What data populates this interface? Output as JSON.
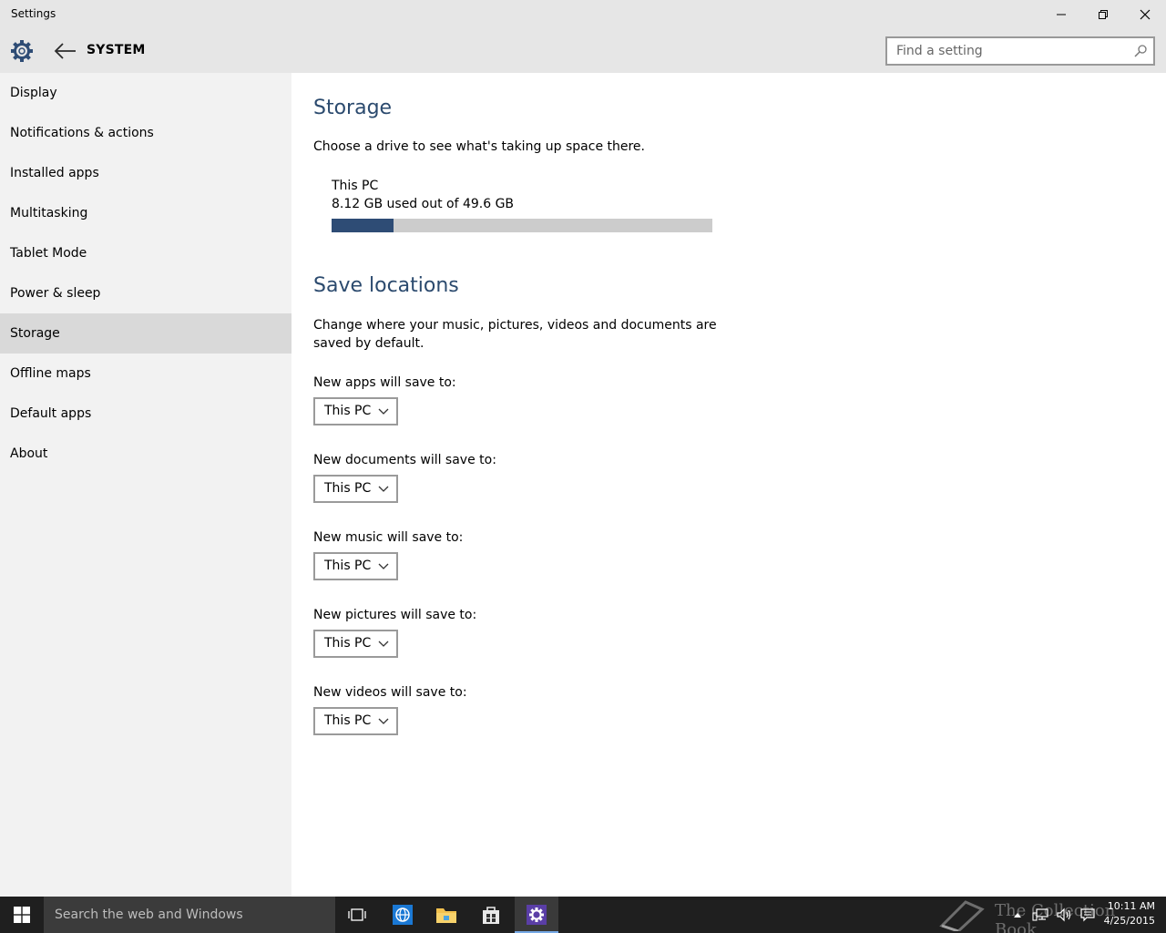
{
  "window": {
    "title": "Settings"
  },
  "header": {
    "section": "SYSTEM",
    "search_placeholder": "Find a setting"
  },
  "sidebar": {
    "items": [
      {
        "label": "Display"
      },
      {
        "label": "Notifications & actions"
      },
      {
        "label": "Installed apps"
      },
      {
        "label": "Multitasking"
      },
      {
        "label": "Tablet Mode"
      },
      {
        "label": "Power & sleep"
      },
      {
        "label": "Storage",
        "active": true
      },
      {
        "label": "Offline maps"
      },
      {
        "label": "Default apps"
      },
      {
        "label": "About"
      }
    ]
  },
  "storage": {
    "heading": "Storage",
    "description": "Choose a drive to see what's taking up space there.",
    "drive": {
      "name": "This PC",
      "usage_text": "8.12 GB used out of 49.6 GB",
      "used_gb": 8.12,
      "total_gb": 49.6
    }
  },
  "save_locations": {
    "heading": "Save locations",
    "description_line1": "Change where your music, pictures, videos and documents are",
    "description_line2": "saved by default.",
    "items": [
      {
        "label": "New apps will save to:",
        "value": "This PC"
      },
      {
        "label": "New documents will save to:",
        "value": "This PC"
      },
      {
        "label": "New music will save to:",
        "value": "This PC"
      },
      {
        "label": "New pictures will save to:",
        "value": "This PC"
      },
      {
        "label": "New videos will save to:",
        "value": "This PC"
      }
    ]
  },
  "taskbar": {
    "search_placeholder": "Search the web and Windows",
    "time": "10:11 AM",
    "date": "4/25/2015",
    "watermark": "The Collection Book"
  },
  "colors": {
    "accent": "#2e4c75",
    "heading": "#2b4a6e",
    "sidebar_bg": "#f2f2f2",
    "selected_bg": "#d9d9d9"
  }
}
